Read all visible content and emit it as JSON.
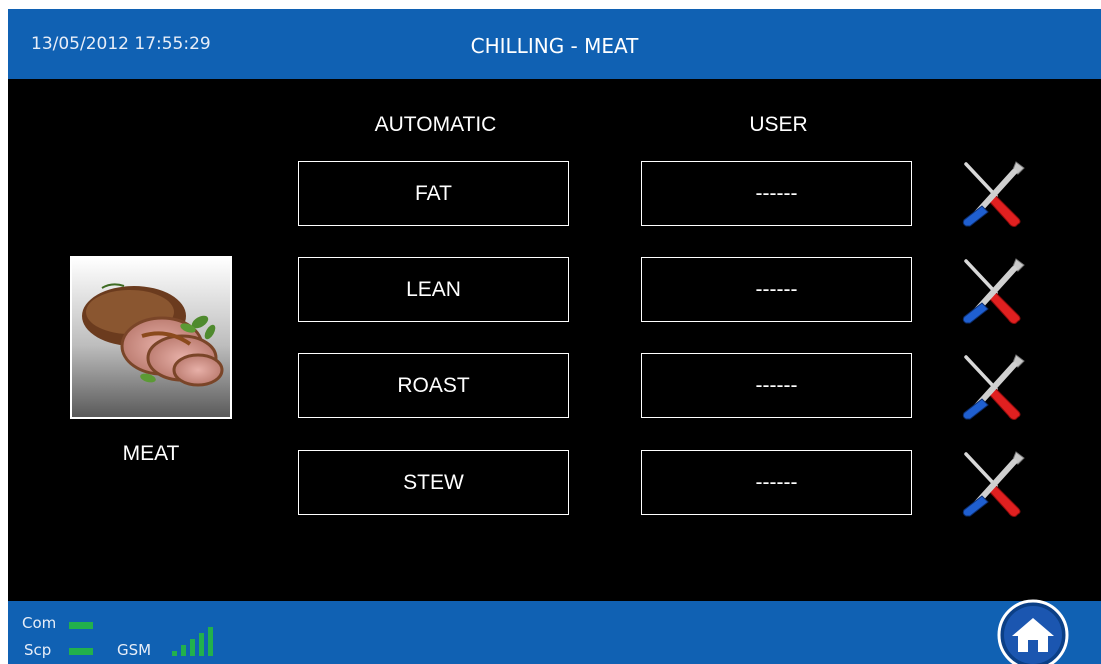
{
  "header": {
    "datetime": "13/05/2012 17:55:29",
    "title": "CHILLING - MEAT"
  },
  "columns": {
    "automatic": "AUTOMATIC",
    "user": "USER"
  },
  "rows": [
    {
      "automatic": "FAT",
      "user": "------",
      "tool_icon": "tools-icon"
    },
    {
      "automatic": "LEAN",
      "user": "------",
      "tool_icon": "tools-icon"
    },
    {
      "automatic": "ROAST",
      "user": "------",
      "tool_icon": "tools-icon"
    },
    {
      "automatic": "STEW",
      "user": "------",
      "tool_icon": "tools-icon"
    }
  ],
  "category": {
    "label": "MEAT",
    "image_icon": "roast-meat-image"
  },
  "status": {
    "com_label": "Com",
    "scp_label": "Scp",
    "gsm_label": "GSM",
    "gsm_signal_bars": 5
  },
  "home_icon": "home-icon",
  "colors": {
    "bar_blue": "#1061b3",
    "background": "#000000",
    "led_green": "#22b14c"
  }
}
